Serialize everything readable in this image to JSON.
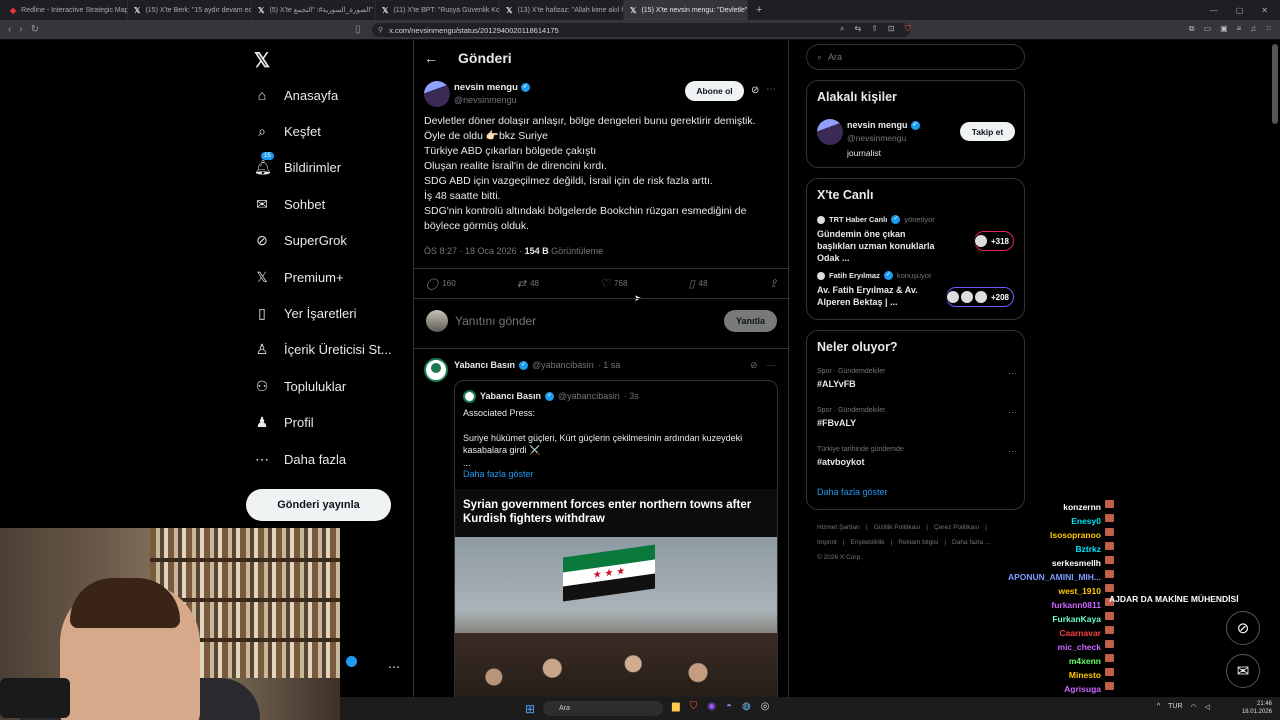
{
  "browser": {
    "tabs": [
      {
        "label": "Redline - Interactive Strategic Map",
        "icon": "redline-favicon",
        "active": false
      },
      {
        "label": "(15) X'te Berk: \"15 aydır devam eden\"",
        "icon": "x-favicon",
        "active": false
      },
      {
        "label": "(5) X'te الصورة_السورية#: \"النجمع\"",
        "icon": "x-favicon",
        "active": false
      },
      {
        "label": "(11) X'te BPT: \"Rusya Güvenlik Konse\"",
        "icon": "x-favicon",
        "active": false
      },
      {
        "label": "(13) X'te hafizaz: \"Allah kime akıl fikir\"",
        "icon": "x-favicon",
        "active": false
      },
      {
        "label": "(15) X'te nevsin mengu: \"Devletle\"",
        "icon": "x-favicon",
        "active": true
      }
    ],
    "url": "x.com/nevsinmengu/status/2012940020118614175"
  },
  "nav": {
    "logo": "𝕏",
    "items": [
      {
        "label": "Anasayfa",
        "icon": "home-icon",
        "glyph": "⌂"
      },
      {
        "label": "Keşfet",
        "icon": "search-icon",
        "glyph": "⌕"
      },
      {
        "label": "Bildirimler",
        "icon": "bell-icon",
        "glyph": "🔔︎",
        "badge": "15"
      },
      {
        "label": "Sohbet",
        "icon": "mail-icon",
        "glyph": "✉"
      },
      {
        "label": "SuperGrok",
        "icon": "grok-icon",
        "glyph": "⊘"
      },
      {
        "label": "Premium+",
        "icon": "x-premium-icon",
        "glyph": "𝕏"
      },
      {
        "label": "Yer İşaretleri",
        "icon": "bookmark-icon",
        "glyph": "▯"
      },
      {
        "label": "İçerik Üreticisi St...",
        "icon": "creator-studio-icon",
        "glyph": "♙"
      },
      {
        "label": "Topluluklar",
        "icon": "communities-icon",
        "glyph": "⚇"
      },
      {
        "label": "Profil",
        "icon": "profile-icon",
        "glyph": "♟"
      },
      {
        "label": "Daha fazla",
        "icon": "more-circle-icon",
        "glyph": "⋯"
      }
    ],
    "post_button": "Gönderi yayınla"
  },
  "main": {
    "title": "Gönderi",
    "post": {
      "name": "nevsin mengu",
      "handle": "@nevsinmengu",
      "subscribe_label": "Abone ol",
      "lines": [
        "Devletler döner dolaşır anlaşır, bölge dengeleri bunu gerektirir demiştik.",
        "Öyle de oldu 👉🏻bkz Suriye",
        "Türkiye ABD çıkarları bölgede çakıştı",
        "Oluşan realite İsrail'in de direncini kırdı.",
        "SDG ABD için vazgeçilmez değildi, İsrail için de risk fazla arttı.",
        "İş 48 saatte bitti.",
        "SDG'nin kontrolü altındaki bölgelerde Bookchin rüzgarı esmediğini de böylece görmüş olduk."
      ],
      "time": "ÖS 8:27 · 18 Oca 2026 ·",
      "views": "154 B",
      "views_label": "Görüntüleme",
      "stats": {
        "replies": "160",
        "reposts": "48",
        "likes": "768",
        "bookmarks": "48"
      }
    },
    "reply": {
      "placeholder": "Yanıtını gönder",
      "button": "Yanıtla"
    },
    "reply_tweet": {
      "name": "Yabancı Basın",
      "handle": "@yabancibasin",
      "time": "· 1 sa",
      "quote": {
        "name": "Yabancı Basın",
        "handle": "@yabancibasin",
        "time": "· 3s",
        "line1": "Associated Press:",
        "line2": "Suriye hükümet güçleri, Kürt güçlerin çekilmesinin ardından kuzeydeki kasabalara girdi ⚔️",
        "line3": "...",
        "show_more": "Daha fazla göster",
        "card_title": "Syrian government forces enter northern towns after Kurdish fighters withdraw"
      }
    }
  },
  "right": {
    "search_placeholder": "Ara",
    "related": {
      "title": "Alakalı kişiler",
      "name": "nevsin mengu",
      "handle": "@nevsinmengu",
      "bio": "journalist",
      "follow": "Takip et"
    },
    "live": {
      "title": "X'te Canlı",
      "items": [
        {
          "host": "TRT Haber Canlı",
          "status": "yönetiyor",
          "title": "Gündemin öne çıkan başlıkları uzman konuklarla Odak ...",
          "count": "+318",
          "color": "#e0245e"
        },
        {
          "host": "Fatih Eryılmaz",
          "status": "konuşuyor",
          "title": "Av. Fatih Eryılmaz & Av. Alperen Bektaş | ...",
          "count": "+208",
          "color": "#7856ff"
        }
      ]
    },
    "trends": {
      "title": "Neler oluyor?",
      "items": [
        {
          "context": "Spor · Gündemdekiler",
          "name": "#ALYvFB"
        },
        {
          "context": "Spor · Gündemdekiler",
          "name": "#FBvALY"
        },
        {
          "context": "Türkiye tarihinde gündemde",
          "name": "#atvboykot"
        }
      ],
      "show_more": "Daha fazla göster"
    },
    "footer": {
      "row1": [
        "Hizmet Şartları",
        "|",
        "Gizlilik Politikası",
        "|",
        "Çerez Politikası",
        "|"
      ],
      "row2": [
        "Imprint",
        "|",
        "Erişilebilirlik",
        "|",
        "Reklam bilgisi",
        "|",
        "Daha fazla ..."
      ],
      "row3": "© 2026 X Corp."
    }
  },
  "chat": {
    "lines": [
      {
        "user": "konzernn",
        "color": "#ffffff"
      },
      {
        "user": "Enesy0",
        "color": "#00e5ff"
      },
      {
        "user": "Isosopranoo",
        "color": "#ffc800"
      },
      {
        "user": "Bztrkz",
        "color": "#00e5ff"
      },
      {
        "user": "serkesmellh",
        "color": "#ffffff"
      },
      {
        "user": "APONUN_AMINI_MIH...",
        "color": "#7d9cff"
      },
      {
        "user": "west_1910",
        "color": "#ffc800"
      },
      {
        "user": "furkann0811",
        "color": "#cc66ff"
      },
      {
        "user": "FurkanKaya",
        "color": "#66ffcc"
      },
      {
        "user": "Caarnavar",
        "color": "#ff4040"
      },
      {
        "user": "mic_check",
        "color": "#cc66ff"
      },
      {
        "user": "m4xenn",
        "color": "#66ff66"
      },
      {
        "user": "Minesto",
        "color": "#ffc800"
      },
      {
        "user": "Agrisuga",
        "color": "#cc66ff"
      }
    ],
    "highlight": "AJDAR DA MAKİNE MÜHENDİSİ"
  },
  "taskbar": {
    "search": "Ara",
    "lang": "TUR",
    "time": "21:46",
    "date": "18.01.2026"
  }
}
